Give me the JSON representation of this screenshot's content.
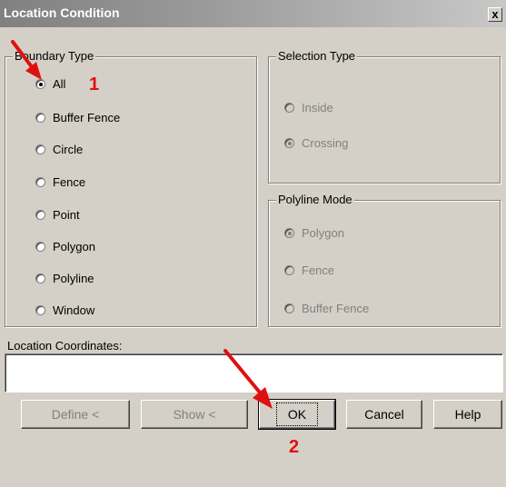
{
  "window": {
    "title": "Location Condition",
    "close_label": "x"
  },
  "boundary_type": {
    "label": "Boundary Type",
    "options": [
      {
        "label": "All",
        "checked": true
      },
      {
        "label": "Buffer Fence",
        "checked": false
      },
      {
        "label": "Circle",
        "checked": false
      },
      {
        "label": "Fence",
        "checked": false
      },
      {
        "label": "Point",
        "checked": false
      },
      {
        "label": "Polygon",
        "checked": false
      },
      {
        "label": "Polyline",
        "checked": false
      },
      {
        "label": "Window",
        "checked": false
      }
    ]
  },
  "selection_type": {
    "label": "Selection Type",
    "options": [
      {
        "label": "Inside",
        "checked": false,
        "enabled": false
      },
      {
        "label": "Crossing",
        "checked": true,
        "enabled": false
      }
    ]
  },
  "polyline_mode": {
    "label": "Polyline Mode",
    "options": [
      {
        "label": "Polygon",
        "checked": true,
        "enabled": false
      },
      {
        "label": "Fence",
        "checked": false,
        "enabled": false
      },
      {
        "label": "Buffer Fence",
        "checked": false,
        "enabled": false
      }
    ]
  },
  "location_coordinates": {
    "label": "Location Coordinates:",
    "value": ""
  },
  "buttons": {
    "define": "Define <",
    "show": "Show <",
    "ok": "OK",
    "cancel": "Cancel",
    "help": "Help"
  },
  "annotations": {
    "step1": "1",
    "step2": "2",
    "color": "#e01010"
  }
}
